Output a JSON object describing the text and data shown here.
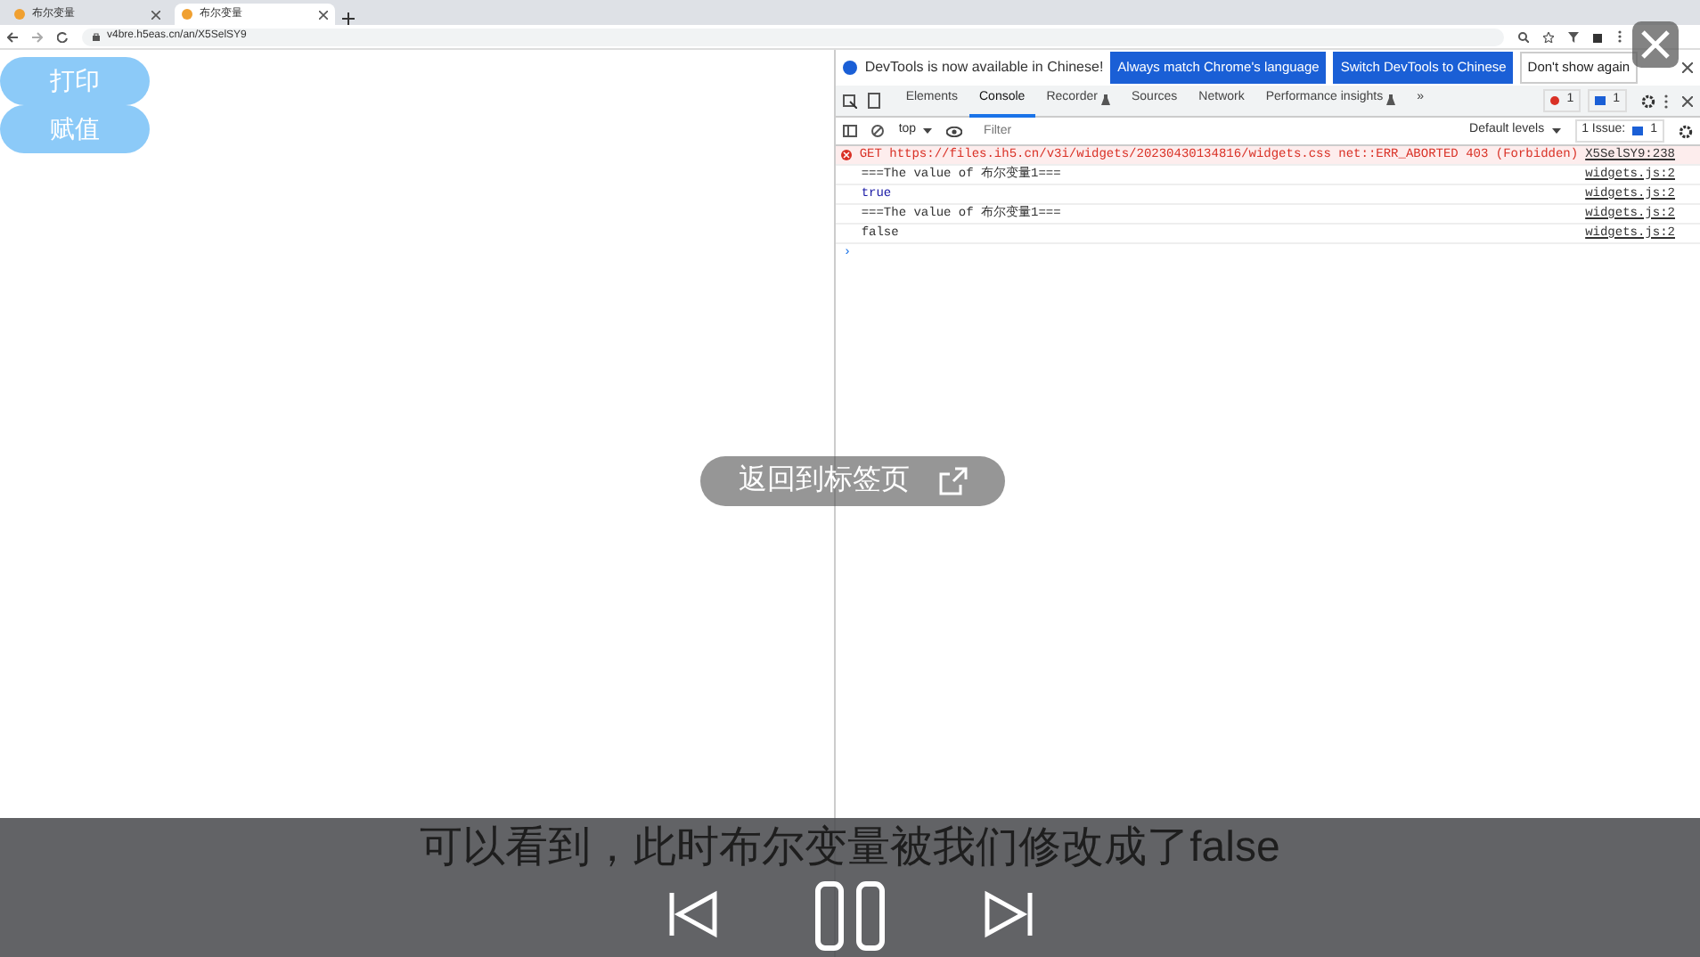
{
  "browser": {
    "tabs": [
      {
        "title": "布尔变量",
        "selected": false
      },
      {
        "title": "布尔变量",
        "selected": true
      }
    ],
    "url": "v4bre.h5eas.cn/an/X5SelSY9"
  },
  "page": {
    "buttons": [
      "打印",
      "赋值"
    ]
  },
  "devtools": {
    "banner": {
      "message": "DevTools is now available in Chinese!",
      "buttons": [
        {
          "label": "Always match Chrome's language",
          "kind": "primary"
        },
        {
          "label": "Switch DevTools to Chinese",
          "kind": "primary"
        },
        {
          "label": "Don't show again",
          "kind": "plain"
        }
      ]
    },
    "tabs": [
      {
        "label": "Elements",
        "selected": false,
        "experimental": false
      },
      {
        "label": "Console",
        "selected": true,
        "experimental": false
      },
      {
        "label": "Recorder",
        "selected": false,
        "experimental": true
      },
      {
        "label": "Sources",
        "selected": false,
        "experimental": false
      },
      {
        "label": "Network",
        "selected": false,
        "experimental": false
      },
      {
        "label": "Performance insights",
        "selected": false,
        "experimental": true
      }
    ],
    "more": "»",
    "error_count": "1",
    "message_count": "1",
    "toolbar": {
      "context": "top",
      "filter_placeholder": "Filter",
      "levels": "Default levels",
      "issues": "1 Issue:",
      "issue_count": "1"
    },
    "console": [
      {
        "kind": "error",
        "text": "GET https://files.ih5.cn/v3i/widgets/20230430134816/widgets.css net::ERR_ABORTED 403 (Forbidden)",
        "source": "X5SelSY9:238"
      },
      {
        "kind": "log",
        "text": "===The value of 布尔变量1===",
        "source": "widgets.js:2"
      },
      {
        "kind": "value",
        "text": "true",
        "source": "widgets.js:2"
      },
      {
        "kind": "log",
        "text": "===The value of 布尔变量1===",
        "source": "widgets.js:2"
      },
      {
        "kind": "log",
        "text": "false",
        "source": "widgets.js:2"
      }
    ],
    "prompt": "›"
  },
  "overlay": {
    "return_label": "返回到标签页",
    "subtitle": "可以看到，此时布尔变量被我们修改成了false"
  }
}
